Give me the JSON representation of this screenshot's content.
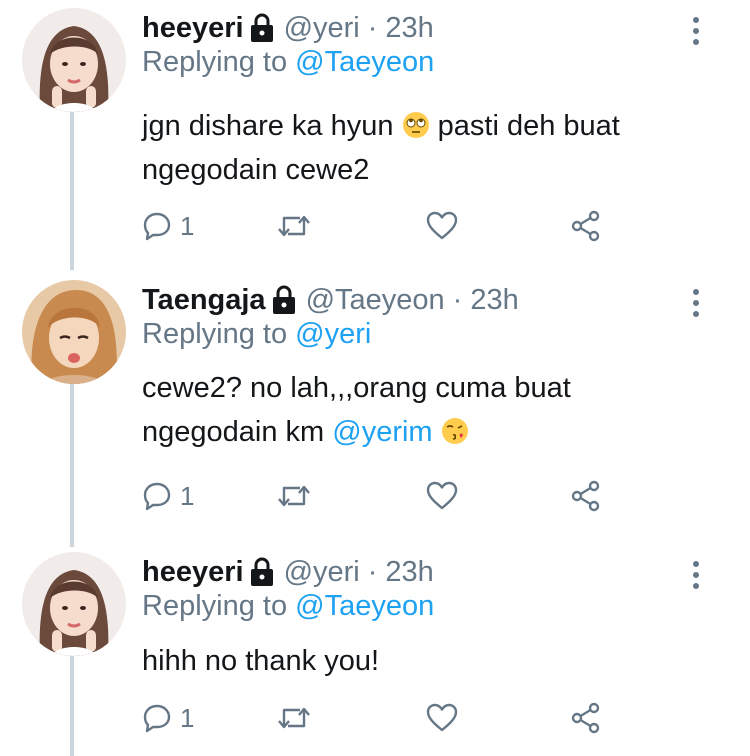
{
  "colors": {
    "text": "#14171a",
    "muted": "#657786",
    "link": "#1da1f2",
    "thread_line": "#ccd6dd"
  },
  "tweets": [
    {
      "name": "heeyeri",
      "handle": "@yeri",
      "separator": "·",
      "time": "23h",
      "replying_prefix": "Replying to",
      "replying_to": "@Taeyeon",
      "body_line1_part1": "jgn dishare ka hyun",
      "body_line1_emoji": "rolling-eyes-emoji",
      "body_line1_part2": "pasti deh buat",
      "body_line2": "ngegodain cewe2",
      "reply_count": "1",
      "protected_icon": "lock-icon"
    },
    {
      "name": "Taengaja",
      "handle": "@Taeyeon",
      "separator": "·",
      "time": "23h",
      "replying_prefix": "Replying to",
      "replying_to": "@yeri",
      "body_line1": "cewe2? no lah,,,orang cuma buat",
      "body_line2_part1": "ngegodain km",
      "body_line2_mention": "@yerim",
      "body_line2_emoji": "kissing-face-emoji",
      "reply_count": "1",
      "protected_icon": "lock-icon"
    },
    {
      "name": "heeyeri",
      "handle": "@yeri",
      "separator": "·",
      "time": "23h",
      "replying_prefix": "Replying to",
      "replying_to": "@Taeyeon",
      "body_line1": "hihh no thank you!",
      "reply_count": "1",
      "protected_icon": "lock-icon"
    }
  ]
}
